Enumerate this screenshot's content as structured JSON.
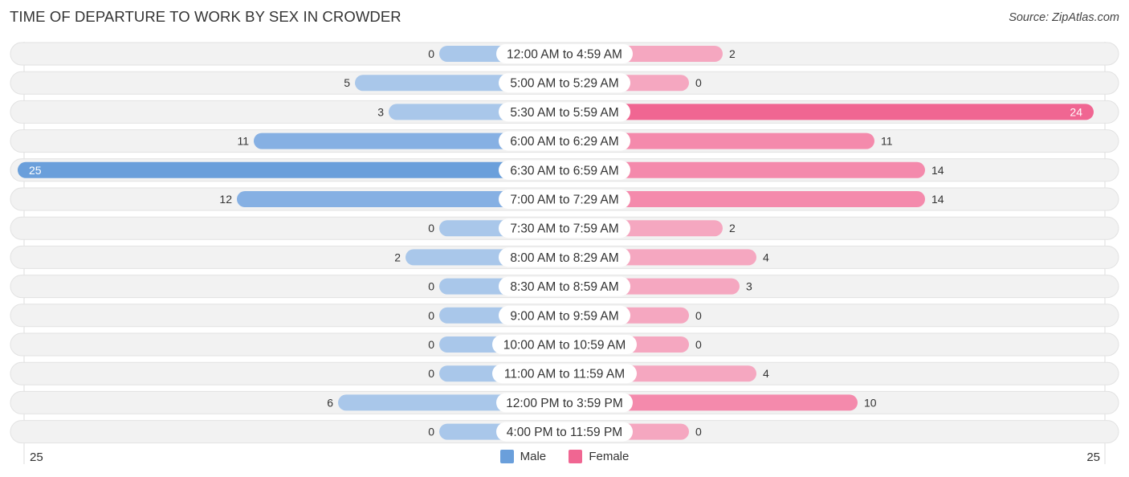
{
  "header": {
    "title": "TIME OF DEPARTURE TO WORK BY SEX IN CROWDER",
    "source": "Source: ZipAtlas.com"
  },
  "colors": {
    "male": "#6a9fdb",
    "male_light": "#a9c7ea",
    "female": "#f06692",
    "female_light": "#f5a7c0",
    "row_bg": "#f2f2f2"
  },
  "chart_data": {
    "type": "bar",
    "orientation": "horizontal-diverging",
    "title": "TIME OF DEPARTURE TO WORK BY SEX IN CROWDER",
    "categories": [
      "12:00 AM to 4:59 AM",
      "5:00 AM to 5:29 AM",
      "5:30 AM to 5:59 AM",
      "6:00 AM to 6:29 AM",
      "6:30 AM to 6:59 AM",
      "7:00 AM to 7:29 AM",
      "7:30 AM to 7:59 AM",
      "8:00 AM to 8:29 AM",
      "8:30 AM to 8:59 AM",
      "9:00 AM to 9:59 AM",
      "10:00 AM to 10:59 AM",
      "11:00 AM to 11:59 AM",
      "12:00 PM to 3:59 PM",
      "4:00 PM to 11:59 PM"
    ],
    "series": [
      {
        "name": "Male",
        "values": [
          0,
          5,
          3,
          11,
          25,
          12,
          0,
          2,
          0,
          0,
          0,
          0,
          6,
          0
        ]
      },
      {
        "name": "Female",
        "values": [
          2,
          0,
          24,
          11,
          14,
          14,
          2,
          4,
          3,
          0,
          0,
          4,
          10,
          0
        ]
      }
    ],
    "axis": {
      "left_max_label": "25",
      "right_max_label": "25",
      "range": [
        0,
        25
      ]
    },
    "legend": {
      "position": "bottom-center",
      "entries": [
        "Male",
        "Female"
      ]
    },
    "grid": false
  }
}
